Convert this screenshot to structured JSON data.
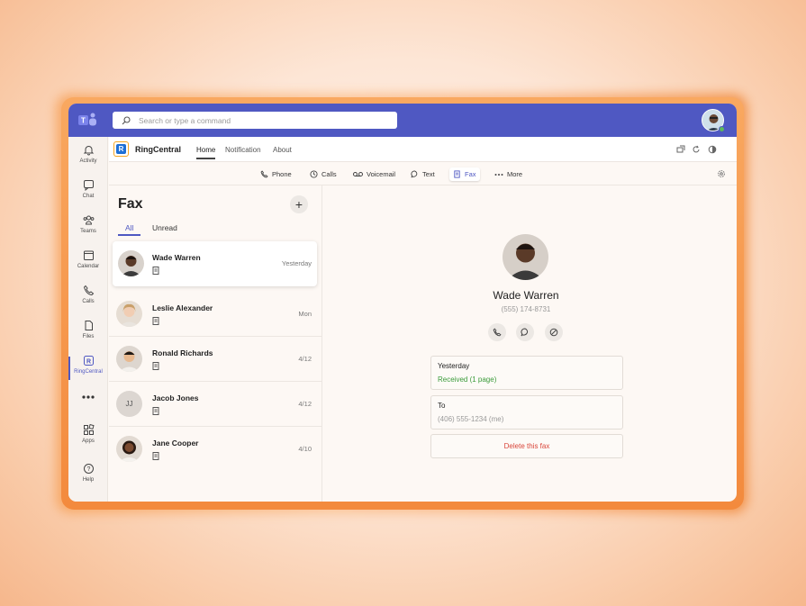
{
  "search": {
    "placeholder": "Search or type a command"
  },
  "rail": {
    "items": [
      {
        "label": "Activity",
        "icon": "bell-icon"
      },
      {
        "label": "Chat",
        "icon": "chat-icon"
      },
      {
        "label": "Teams",
        "icon": "teams-icon"
      },
      {
        "label": "Calendar",
        "icon": "calendar-icon"
      },
      {
        "label": "Calls",
        "icon": "phone-icon"
      },
      {
        "label": "Files",
        "icon": "file-icon"
      },
      {
        "label": "RingCentral",
        "icon": "ringcentral-icon"
      },
      {
        "label": "",
        "icon": "more-icon"
      },
      {
        "label": "Apps",
        "icon": "apps-icon"
      },
      {
        "label": "Help",
        "icon": "help-icon"
      }
    ]
  },
  "app": {
    "name": "RingCentral",
    "tabs": [
      "Home",
      "Notification",
      "About"
    ]
  },
  "nav": {
    "items": [
      "Phone",
      "Calls",
      "Voicemail",
      "Text",
      "Fax",
      "More"
    ],
    "active": "Fax"
  },
  "list": {
    "title": "Fax",
    "filters": [
      "All",
      "Unread"
    ],
    "items": [
      {
        "name": "Wade Warren",
        "date": "Yesterday"
      },
      {
        "name": "Leslie Alexander",
        "date": "Mon"
      },
      {
        "name": "Ronald Richards",
        "date": "4/12"
      },
      {
        "name": "Jacob Jones",
        "date": "4/12",
        "initials": "JJ"
      },
      {
        "name": "Jane Cooper",
        "date": "4/10"
      }
    ]
  },
  "detail": {
    "name": "Wade Warren",
    "phone": "(555) 174-8731",
    "received_label": "Yesterday",
    "received_value": "Received (1 page)",
    "to_label": "To",
    "to_value": "(406) 555-1234 (me)",
    "delete_label": "Delete this fax"
  },
  "colors": {
    "brand": "#4f58c2",
    "received": "#3a9b3a",
    "delete": "#d9453a"
  }
}
